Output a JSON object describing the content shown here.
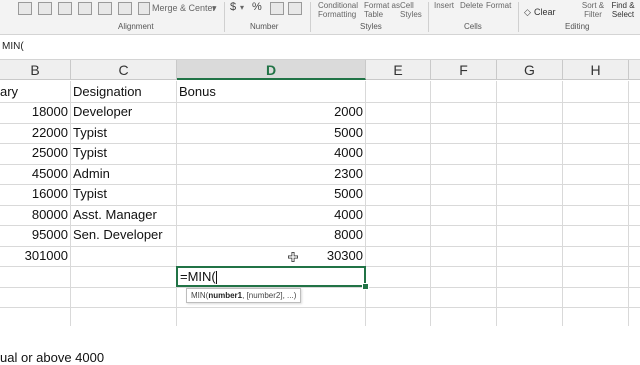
{
  "ribbon": {
    "merge_center": "Merge & Center",
    "alignment_group": "Alignment",
    "currency_symbol": "$",
    "percent_symbol": "%",
    "number_group": "Number",
    "conditional_formatting": "Conditional Formatting",
    "format_as_table": "Format as Table",
    "cell_styles": "Cell Styles",
    "styles_group": "Styles",
    "insert": "Insert",
    "delete": "Delete",
    "format": "Format",
    "cells_group": "Cells",
    "clear": "Clear",
    "sort_filter": "Sort & Filter",
    "find_select": "Find & Select",
    "editing_group": "Editing"
  },
  "formula_bar": {
    "content": "MIN("
  },
  "columns": [
    "B",
    "C",
    "D",
    "E",
    "F",
    "G",
    "H"
  ],
  "selected_column": "D",
  "header_row": {
    "b": "ary",
    "c": "Designation",
    "d": "Bonus"
  },
  "rows": [
    {
      "b": "18000",
      "c": "Developer",
      "d": "2000"
    },
    {
      "b": "22000",
      "c": "Typist",
      "d": "5000"
    },
    {
      "b": "25000",
      "c": "Typist",
      "d": "4000"
    },
    {
      "b": "45000",
      "c": "Admin",
      "d": "2300"
    },
    {
      "b": "16000",
      "c": "Typist",
      "d": "5000"
    },
    {
      "b": "80000",
      "c": "Asst. Manager",
      "d": "4000"
    },
    {
      "b": "95000",
      "c": "Sen. Developer",
      "d": "8000"
    },
    {
      "b": "301000",
      "c": "",
      "d": "30300"
    }
  ],
  "active_cell": {
    "value": "=MIN("
  },
  "tooltip": {
    "func": "MIN(",
    "arg1": "number1",
    "rest": ", [number2], ...)"
  },
  "bottom_note": "ual or above 4000",
  "colors": {
    "accent": "#217346",
    "grid": "#d9d9d9",
    "header_bg": "#efefef"
  }
}
